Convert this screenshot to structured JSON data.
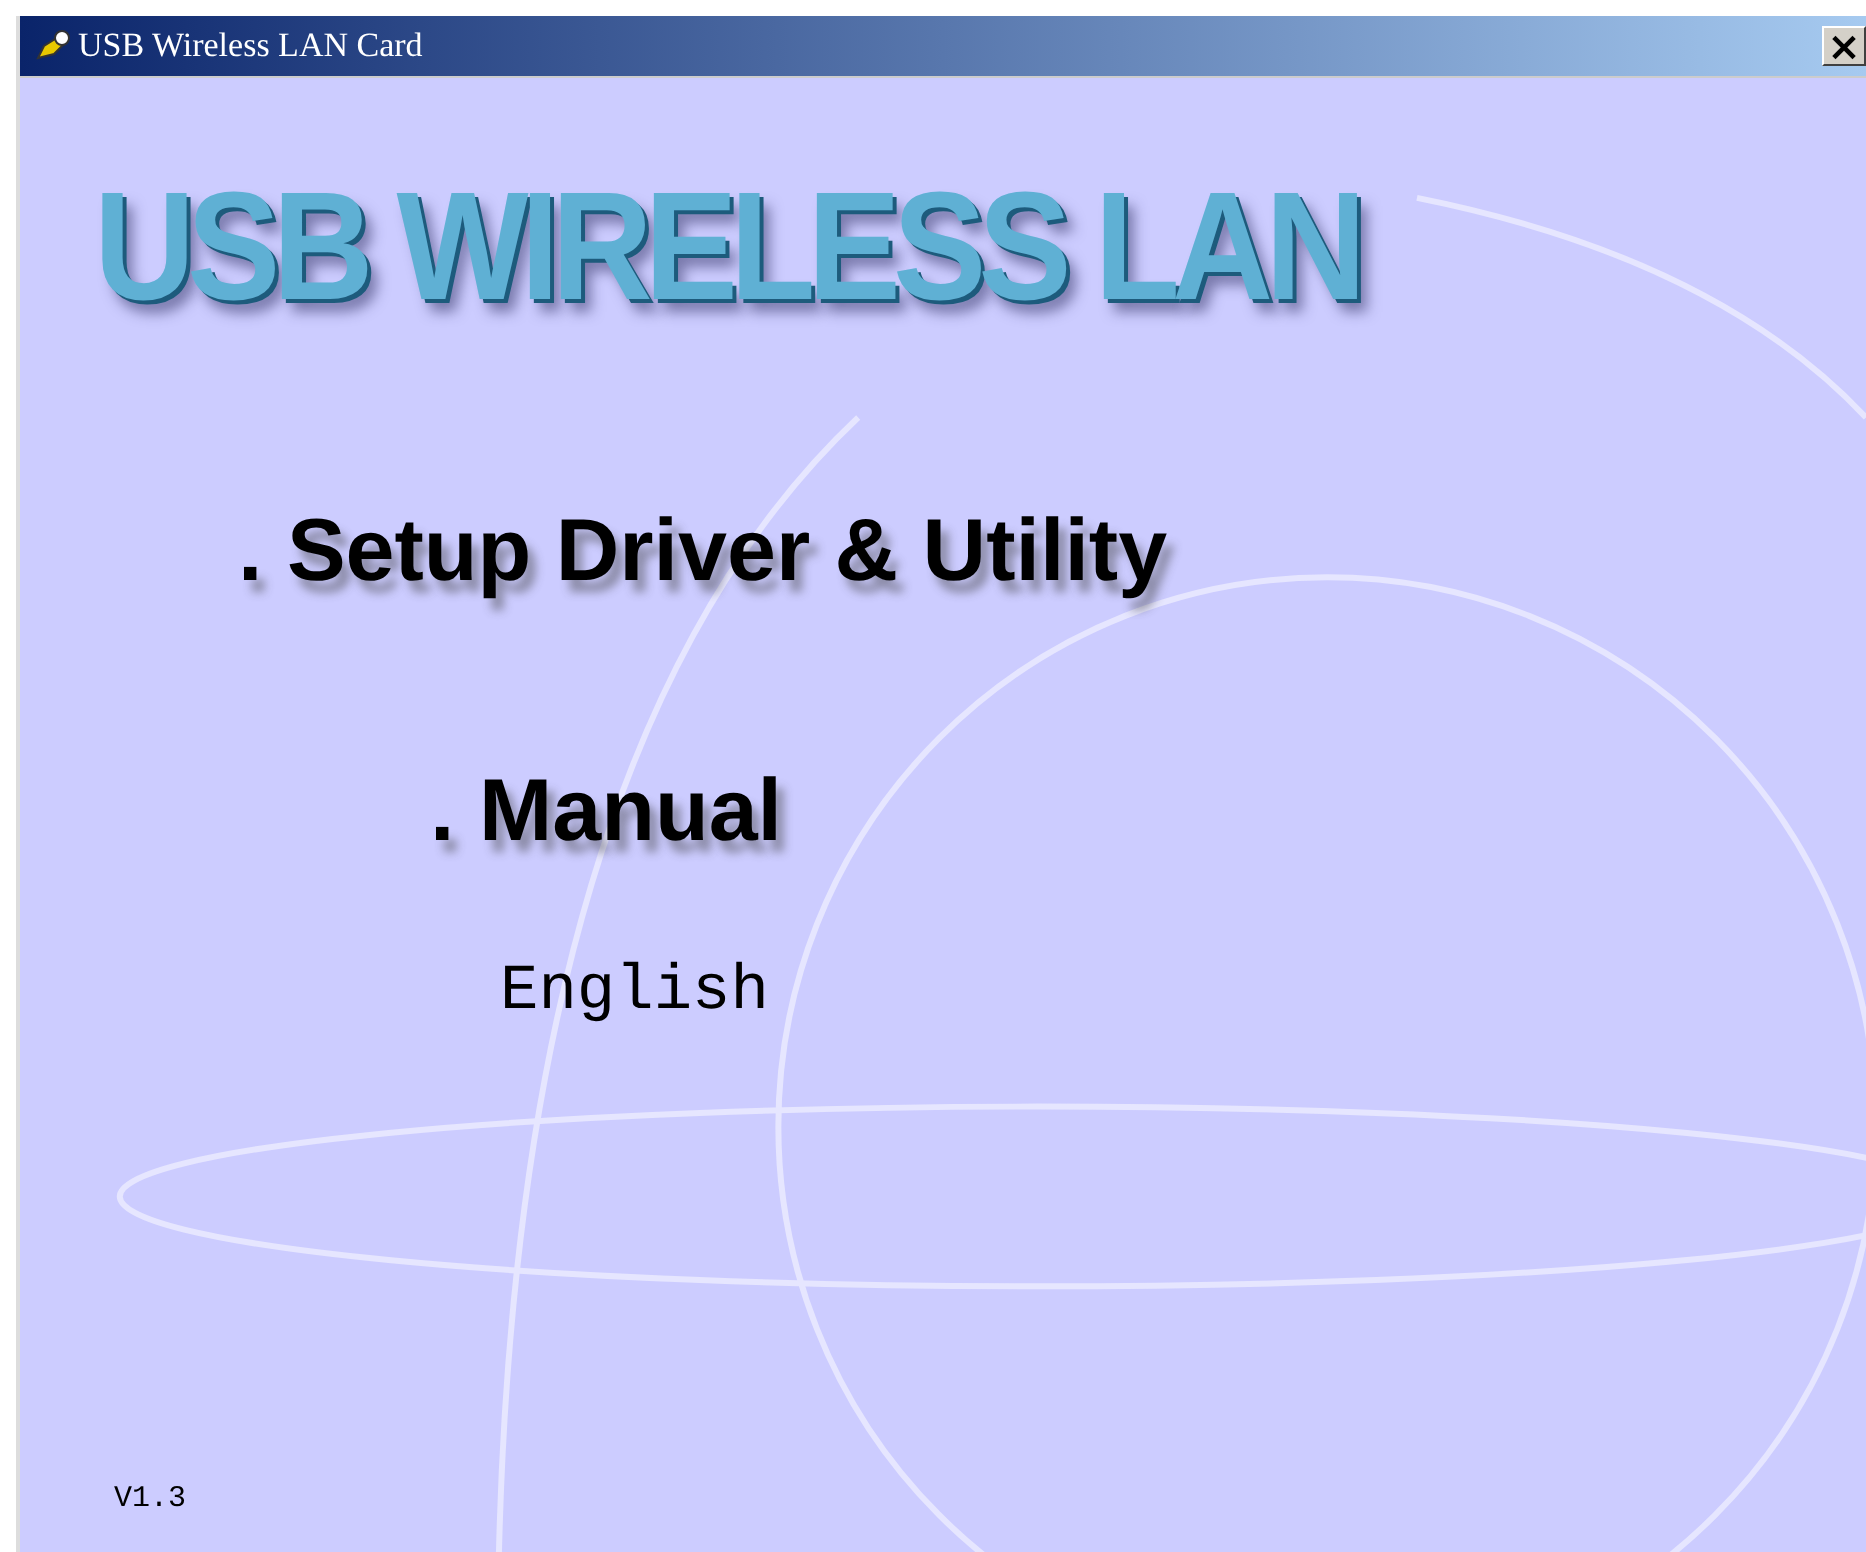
{
  "window": {
    "title": "USB Wireless LAN Card",
    "close": "×"
  },
  "logo": "USB WIRELESS LAN",
  "menu": [
    {
      "label": ". Setup Driver & Utility",
      "kind": "main"
    },
    {
      "label": ". Manual",
      "kind": "sub"
    }
  ],
  "languages": [
    "English"
  ],
  "version": "V1.3"
}
